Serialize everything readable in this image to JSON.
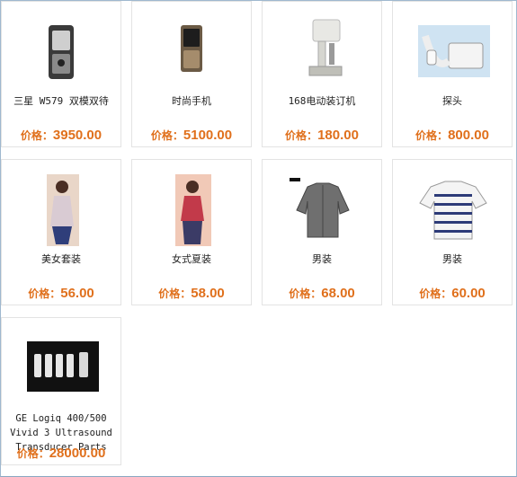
{
  "price_label": "价格：",
  "colors": {
    "price": "#e0701c",
    "border": "#e3e3e3",
    "frame": "#9fb8cf"
  },
  "products": [
    {
      "name": "三星 W579 双模双待",
      "price": "3950.00",
      "image": "phone-silver-icon"
    },
    {
      "name": "时尚手机",
      "price": "5100.00",
      "image": "phone-bronze-icon"
    },
    {
      "name": "168电动装订机",
      "price": "180.00",
      "image": "binding-machine-icon"
    },
    {
      "name": "探头",
      "price": "800.00",
      "image": "ultrasound-probe-icon"
    },
    {
      "name": "美女套装",
      "price": "56.00",
      "image": "dress-outfit-icon"
    },
    {
      "name": "女式夏装",
      "price": "58.00",
      "image": "summer-outfit-icon"
    },
    {
      "name": "男装",
      "price": "68.00",
      "image": "gray-shirt-icon"
    },
    {
      "name": "男装",
      "price": "60.00",
      "image": "striped-polo-icon"
    },
    {
      "name": "GE Logiq 400/500 Vivid 3 Ultrasound Transducer Parts",
      "price": "28000.00",
      "image": "transducer-parts-icon"
    }
  ]
}
